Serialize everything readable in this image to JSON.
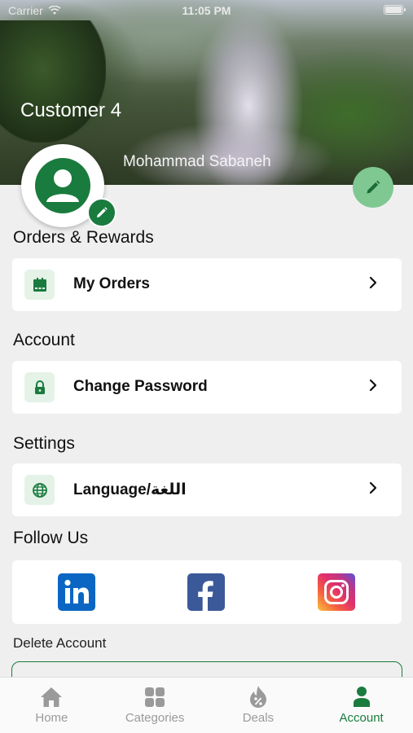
{
  "status_bar": {
    "carrier": "Carrier",
    "time": "11:05 PM"
  },
  "header": {
    "customer_title": "Customer 4",
    "user_name": "Mohammad Sabaneh"
  },
  "sections": {
    "orders": {
      "title": "Orders & Rewards",
      "item_label": "My Orders"
    },
    "account": {
      "title": "Account",
      "item_label": "Change Password"
    },
    "settings": {
      "title": "Settings",
      "item_label": "Language/اللغة"
    },
    "follow": {
      "title": "Follow Us",
      "icons": [
        "linkedin-icon",
        "facebook-icon",
        "instagram-icon"
      ]
    }
  },
  "delete_account": "Delete Account",
  "tabs": [
    {
      "label": "Home",
      "icon": "home-icon"
    },
    {
      "label": "Categories",
      "icon": "categories-icon"
    },
    {
      "label": "Deals",
      "icon": "deals-icon"
    },
    {
      "label": "Account",
      "icon": "account-icon",
      "active": true
    }
  ],
  "colors": {
    "primary": "#1a7b3e",
    "fab": "#7fc892",
    "background": "#efefef",
    "linkedin": "#0a66c2",
    "facebook": "#3b5998"
  }
}
